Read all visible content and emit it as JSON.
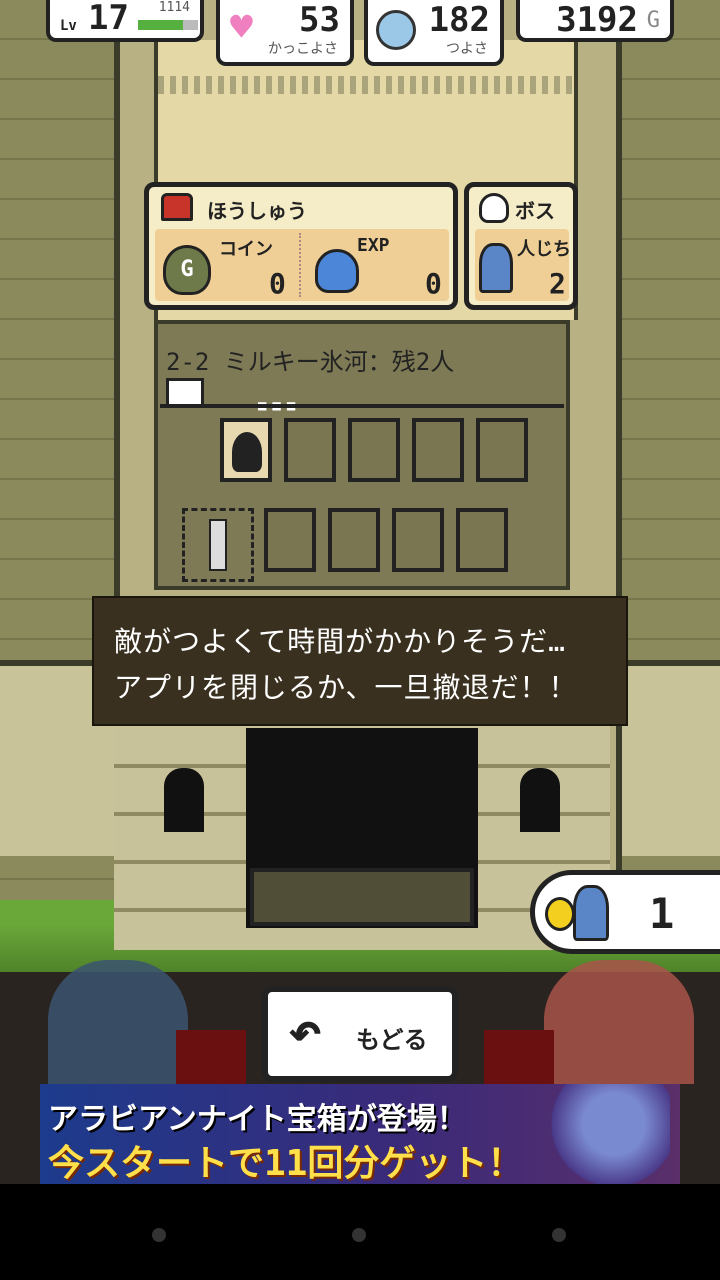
{
  "hud": {
    "level_label": "Lv",
    "level": "17",
    "exp": "1114",
    "exp_fraction": 0.75,
    "charm_value": "53",
    "charm_label": "かっこよさ",
    "power_value": "182",
    "power_label": "つよさ",
    "gold_value": "3192",
    "gold_suffix": "G"
  },
  "reward": {
    "title": "ほうしゅう",
    "coin_label": "コイン",
    "coin_value": "0",
    "coin_icon_letter": "G",
    "exp_label": "EXP",
    "exp_value": "0"
  },
  "boss": {
    "title": "ボス",
    "hostage_label": "人じち",
    "hostage_value": "2"
  },
  "stage": {
    "label": "2-2 ミルキー氷河：残2人"
  },
  "message": {
    "line1": "敵がつよくて時間がかかりそうだ…",
    "line2": "アプリを閉じるか、一旦撤退だ！！"
  },
  "hostage_counter": {
    "value": "1"
  },
  "back_button": {
    "label": "もどる"
  },
  "banner": {
    "line1": "アラビアンナイト宝箱が登場！",
    "line2": "今スタートで11回分ゲット！"
  },
  "icons": {
    "charm": "heart-icon",
    "power": "shield-icon",
    "reward": "chest-icon",
    "coin": "coinbag-icon",
    "exp": "slime-icon",
    "boss": "skull-icon",
    "hostage": "girl-icon",
    "back": "back-arrow-icon"
  }
}
